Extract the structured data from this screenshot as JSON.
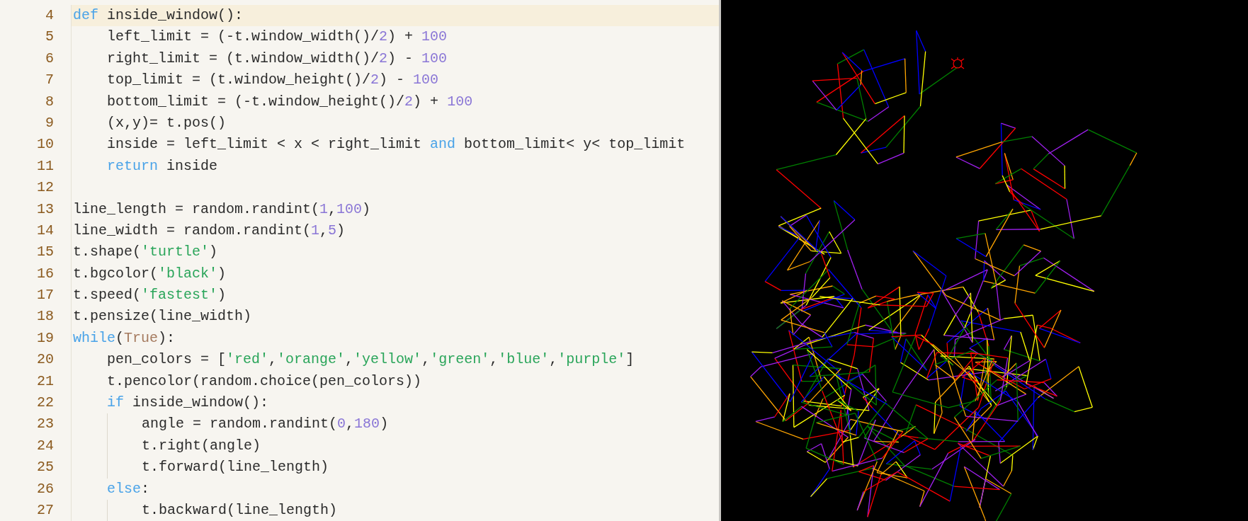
{
  "editor": {
    "lines": [
      {
        "number": "4",
        "current": true,
        "tokens": [
          {
            "kind": "keyword",
            "text": "def"
          },
          {
            "kind": "plain",
            "text": " inside_window():"
          }
        ]
      },
      {
        "number": "5",
        "current": false,
        "tokens": [
          {
            "kind": "plain",
            "text": "    left_limit = (-t.window_width()/"
          },
          {
            "kind": "number",
            "text": "2"
          },
          {
            "kind": "plain",
            "text": ") + "
          },
          {
            "kind": "number",
            "text": "100"
          }
        ]
      },
      {
        "number": "6",
        "current": false,
        "tokens": [
          {
            "kind": "plain",
            "text": "    right_limit = (t.window_width()/"
          },
          {
            "kind": "number",
            "text": "2"
          },
          {
            "kind": "plain",
            "text": ") - "
          },
          {
            "kind": "number",
            "text": "100"
          }
        ]
      },
      {
        "number": "7",
        "current": false,
        "tokens": [
          {
            "kind": "plain",
            "text": "    top_limit = (t.window_height()/"
          },
          {
            "kind": "number",
            "text": "2"
          },
          {
            "kind": "plain",
            "text": ") - "
          },
          {
            "kind": "number",
            "text": "100"
          }
        ]
      },
      {
        "number": "8",
        "current": false,
        "tokens": [
          {
            "kind": "plain",
            "text": "    bottom_limit = (-t.window_height()/"
          },
          {
            "kind": "number",
            "text": "2"
          },
          {
            "kind": "plain",
            "text": ") + "
          },
          {
            "kind": "number",
            "text": "100"
          }
        ]
      },
      {
        "number": "9",
        "current": false,
        "tokens": [
          {
            "kind": "plain",
            "text": "    (x,y)= t.pos()"
          }
        ]
      },
      {
        "number": "10",
        "current": false,
        "tokens": [
          {
            "kind": "plain",
            "text": "    inside = left_limit < x < right_limit "
          },
          {
            "kind": "keyword",
            "text": "and"
          },
          {
            "kind": "plain",
            "text": " bottom_limit< y< top_limit"
          }
        ]
      },
      {
        "number": "11",
        "current": false,
        "tokens": [
          {
            "kind": "keyword",
            "text": "    return"
          },
          {
            "kind": "plain",
            "text": " inside"
          }
        ]
      },
      {
        "number": "12",
        "current": false
      },
      {
        "number": "13",
        "current": false,
        "tokens": [
          {
            "kind": "plain",
            "text": "line_length = random.randint("
          },
          {
            "kind": "number",
            "text": "1"
          },
          {
            "kind": "plain",
            "text": ","
          },
          {
            "kind": "number",
            "text": "100"
          },
          {
            "kind": "plain",
            "text": ")"
          }
        ]
      },
      {
        "number": "14",
        "current": false,
        "tokens": [
          {
            "kind": "plain",
            "text": "line_width = random.randint("
          },
          {
            "kind": "number",
            "text": "1"
          },
          {
            "kind": "plain",
            "text": ","
          },
          {
            "kind": "number",
            "text": "5"
          },
          {
            "kind": "plain",
            "text": ")"
          }
        ]
      },
      {
        "number": "15",
        "current": false,
        "tokens": [
          {
            "kind": "plain",
            "text": "t.shape("
          },
          {
            "kind": "string",
            "text": "'turtle'"
          },
          {
            "kind": "plain",
            "text": ")"
          }
        ]
      },
      {
        "number": "16",
        "current": false,
        "tokens": [
          {
            "kind": "plain",
            "text": "t.bgcolor("
          },
          {
            "kind": "string",
            "text": "'black'"
          },
          {
            "kind": "plain",
            "text": ")"
          }
        ]
      },
      {
        "number": "17",
        "current": false,
        "tokens": [
          {
            "kind": "plain",
            "text": "t.speed("
          },
          {
            "kind": "string",
            "text": "'fastest'"
          },
          {
            "kind": "plain",
            "text": ")"
          }
        ]
      },
      {
        "number": "18",
        "current": false,
        "tokens": [
          {
            "kind": "plain",
            "text": "t.pensize(line_width)"
          }
        ]
      },
      {
        "number": "19",
        "current": false,
        "tokens": [
          {
            "kind": "keyword",
            "text": "while"
          },
          {
            "kind": "plain",
            "text": "("
          },
          {
            "kind": "constant",
            "text": "True"
          },
          {
            "kind": "plain",
            "text": "):"
          }
        ]
      },
      {
        "number": "20",
        "current": false,
        "tokens": [
          {
            "kind": "plain",
            "text": "    pen_colors = ["
          },
          {
            "kind": "string",
            "text": "'red'"
          },
          {
            "kind": "plain",
            "text": ","
          },
          {
            "kind": "string",
            "text": "'orange'"
          },
          {
            "kind": "plain",
            "text": ","
          },
          {
            "kind": "string",
            "text": "'yellow'"
          },
          {
            "kind": "plain",
            "text": ","
          },
          {
            "kind": "string",
            "text": "'green'"
          },
          {
            "kind": "plain",
            "text": ","
          },
          {
            "kind": "string",
            "text": "'blue'"
          },
          {
            "kind": "plain",
            "text": ","
          },
          {
            "kind": "string",
            "text": "'purple'"
          },
          {
            "kind": "plain",
            "text": "]"
          }
        ]
      },
      {
        "number": "21",
        "current": false,
        "tokens": [
          {
            "kind": "plain",
            "text": "    t.pencolor(random.choice(pen_colors))"
          }
        ]
      },
      {
        "number": "22",
        "current": false,
        "tokens": [
          {
            "kind": "keyword",
            "text": "    if"
          },
          {
            "kind": "plain",
            "text": " inside_window():"
          }
        ]
      },
      {
        "number": "23",
        "current": false,
        "tokens": [
          {
            "kind": "plain",
            "text": "        angle = random.randint("
          },
          {
            "kind": "number",
            "text": "0"
          },
          {
            "kind": "plain",
            "text": ","
          },
          {
            "kind": "number",
            "text": "180"
          },
          {
            "kind": "plain",
            "text": ")"
          }
        ]
      },
      {
        "number": "24",
        "current": false,
        "tokens": [
          {
            "kind": "plain",
            "text": "        t.right(angle)"
          }
        ]
      },
      {
        "number": "25",
        "current": false,
        "tokens": [
          {
            "kind": "plain",
            "text": "        t.forward(line_length)"
          }
        ]
      },
      {
        "number": "26",
        "current": false,
        "tokens": [
          {
            "kind": "keyword",
            "text": "    else"
          },
          {
            "kind": "plain",
            "text": ":"
          }
        ]
      },
      {
        "number": "27",
        "current": false,
        "tokens": [
          {
            "kind": "plain",
            "text": "        t.backward(line_length)"
          }
        ]
      }
    ]
  }
}
